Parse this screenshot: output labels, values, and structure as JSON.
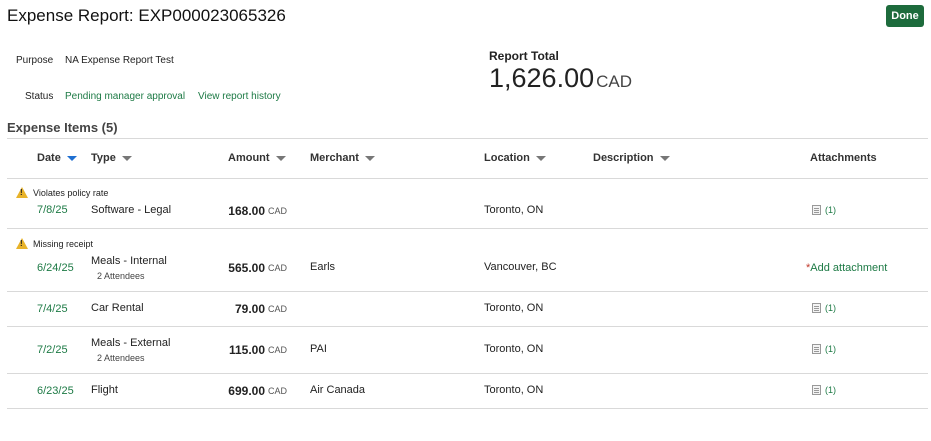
{
  "header": {
    "title": "Expense Report: EXP000023065326",
    "done_label": "Done"
  },
  "info": {
    "purpose_label": "Purpose",
    "purpose_value": "NA Expense Report Test",
    "status_label": "Status",
    "status_value": "Pending manager approval",
    "history_link": "View report history"
  },
  "total": {
    "label": "Report Total",
    "amount": "1,626.00",
    "currency": "CAD"
  },
  "items_section": {
    "title": "Expense Items (5)",
    "columns": {
      "date": "Date",
      "type": "Type",
      "amount": "Amount",
      "merchant": "Merchant",
      "location": "Location",
      "description": "Description",
      "attachments": "Attachments"
    },
    "rows": [
      {
        "warning": "Violates policy rate",
        "date": "7/8/25",
        "type": "Software - Legal",
        "subtext": "",
        "amount": "168.00",
        "currency": "CAD",
        "merchant": "",
        "location": "Toronto, ON",
        "attachment": "(1)"
      },
      {
        "warning": "Missing receipt",
        "date": "6/24/25",
        "type": "Meals - Internal",
        "subtext": "2 Attendees",
        "amount": "565.00",
        "currency": "CAD",
        "merchant": "Earls",
        "location": "Vancouver, BC",
        "add_attachment_star": "*",
        "add_attachment": "Add attachment"
      },
      {
        "warning": "",
        "date": "7/4/25",
        "type": "Car Rental",
        "subtext": "",
        "amount": "79.00",
        "currency": "CAD",
        "merchant": "",
        "location": "Toronto, ON",
        "attachment": "(1)"
      },
      {
        "warning": "",
        "date": "7/2/25",
        "type": "Meals - External",
        "subtext": "2 Attendees",
        "amount": "115.00",
        "currency": "CAD",
        "merchant": "PAI",
        "location": "Toronto, ON",
        "attachment": "(1)"
      },
      {
        "warning": "",
        "date": "6/23/25",
        "type": "Flight",
        "subtext": "",
        "amount": "699.00",
        "currency": "CAD",
        "merchant": "Air Canada",
        "location": "Toronto, ON",
        "attachment": "(1)"
      }
    ]
  },
  "colors": {
    "accent_green": "#1d7a45",
    "done_button": "#1d6b3c",
    "sort_active": "#1f6fd1",
    "warning": "#e8b32a"
  }
}
